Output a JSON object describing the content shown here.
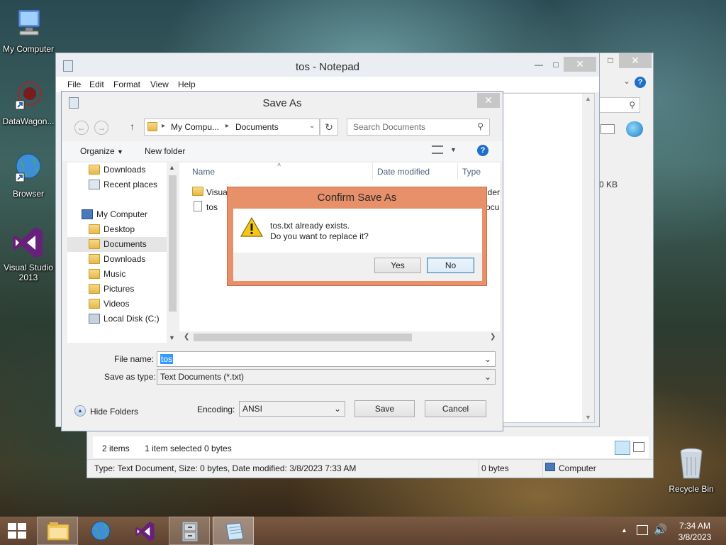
{
  "desktop": {
    "icons": [
      {
        "label": "My Computer"
      },
      {
        "label": "DataWagon..."
      },
      {
        "label": "Browser"
      },
      {
        "label": "Visual Studio 2013"
      },
      {
        "label": "Recycle Bin"
      }
    ]
  },
  "explorer_bg": {
    "size_value": "0 KB",
    "status_items": "2 items",
    "status_selected": "1 item selected  0 bytes",
    "details": "Type: Text Document, Size: 0 bytes, Date modified: 3/8/2023 7:33 AM",
    "details_size": "0 bytes",
    "details_location": "Computer"
  },
  "notepad": {
    "title": "tos - Notepad",
    "menu": [
      "File",
      "Edit",
      "Format",
      "View",
      "Help"
    ]
  },
  "save_as": {
    "title": "Save As",
    "breadcrumb": [
      "My Compu...",
      "Documents"
    ],
    "search_placeholder": "Search Documents",
    "organize": "Organize",
    "new_folder": "New folder",
    "nav": {
      "favorites": [
        "Downloads",
        "Recent places"
      ],
      "computer": "My Computer",
      "computer_items": [
        "Desktop",
        "Documents",
        "Downloads",
        "Music",
        "Pictures",
        "Videos",
        "Local Disk (C:)"
      ]
    },
    "columns": [
      "Name",
      "Date modified",
      "Type"
    ],
    "files": [
      {
        "name": "Visua",
        "type": "lder"
      },
      {
        "name": "tos",
        "type": "ocu"
      }
    ],
    "file_name_label": "File name:",
    "file_name_value": "tos",
    "save_type_label": "Save as type:",
    "save_type_value": "Text Documents (*.txt)",
    "hide_folders": "Hide Folders",
    "encoding_label": "Encoding:",
    "encoding_value": "ANSI",
    "save_button": "Save",
    "cancel_button": "Cancel"
  },
  "confirm": {
    "title": "Confirm Save As",
    "line1": "tos.txt already exists.",
    "line2": "Do you want to replace it?",
    "yes": "Yes",
    "no": "No"
  },
  "taskbar": {
    "time": "7:34 AM",
    "date": "3/8/2023"
  },
  "colors": {
    "confirm_frame": "#e8906a",
    "taskbar": "#6e4f38",
    "selection": "#3399ff"
  }
}
